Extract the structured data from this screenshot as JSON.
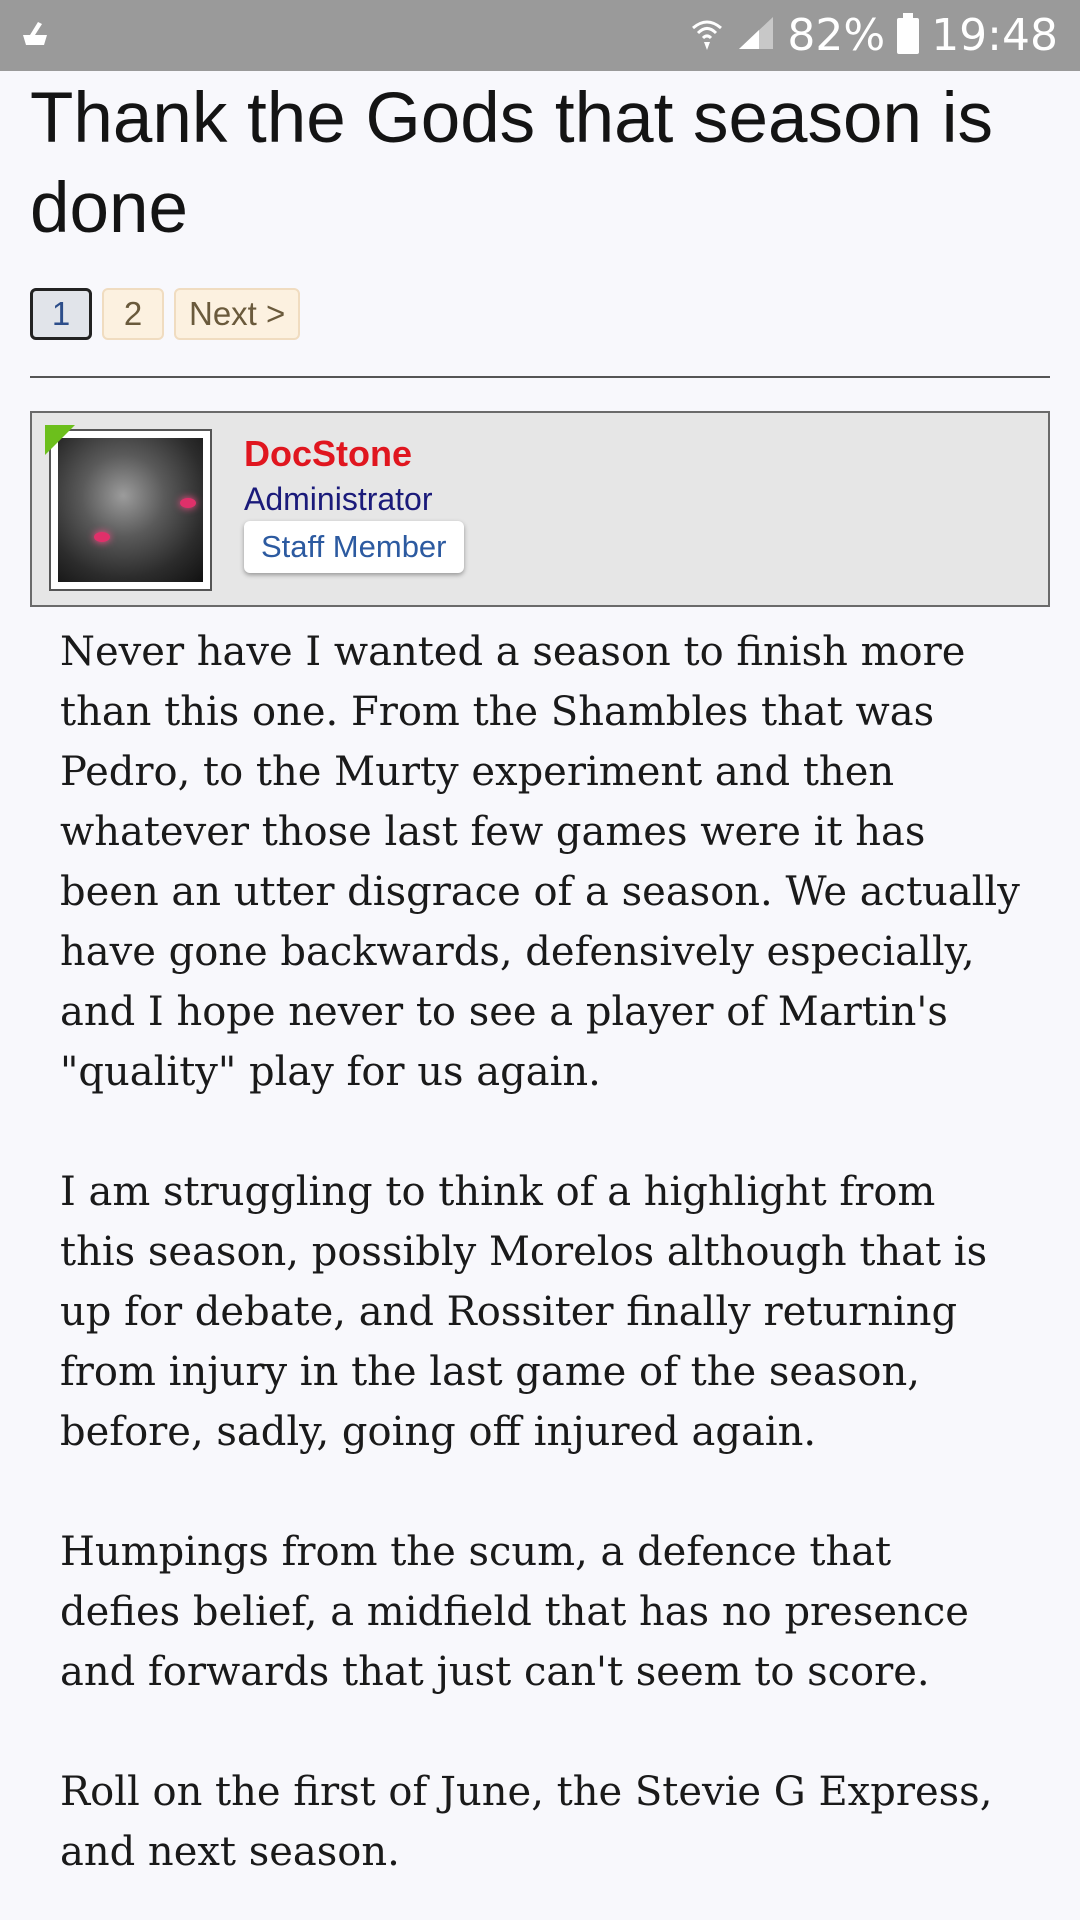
{
  "status_bar": {
    "battery": "82%",
    "time": "19:48",
    "icons": [
      "cleaner-notification-icon",
      "wifi-icon",
      "signal-icon",
      "battery-icon"
    ]
  },
  "thread": {
    "title": "Thank the Gods that season is done"
  },
  "pagination": {
    "pages": [
      "1",
      "2"
    ],
    "current": "1",
    "next_label": "Next >"
  },
  "post": {
    "author": {
      "name": "DocStone",
      "role": "Administrator",
      "badge": "Staff Member",
      "online": true
    },
    "paragraphs": [
      "Never have I wanted a season to finish more than this one. From the Shambles that was Pedro, to the Murty experiment and then whatever those last few games were it has been an utter disgrace of a season. We actually have gone backwards, defensively especially, and I hope never to see a player of Martin's \"quality\" play for us again.",
      "I am struggling to think of a highlight from this season, possibly Morelos although that is up for debate, and Rossiter finally returning from injury in the last game of the season, before, sadly, going off injured again.",
      "Humpings from the scum, a defence that defies belief, a midfield that has no presence and forwards that just can't seem to score.",
      "Roll on the first of June, the Stevie G Express, and next season."
    ]
  },
  "colors": {
    "status_bar": "#9a9a9a",
    "username": "#e0161f",
    "role": "#1a1a7a",
    "badge_text": "#2c5aa0",
    "online_indicator": "#6cbf1c"
  }
}
